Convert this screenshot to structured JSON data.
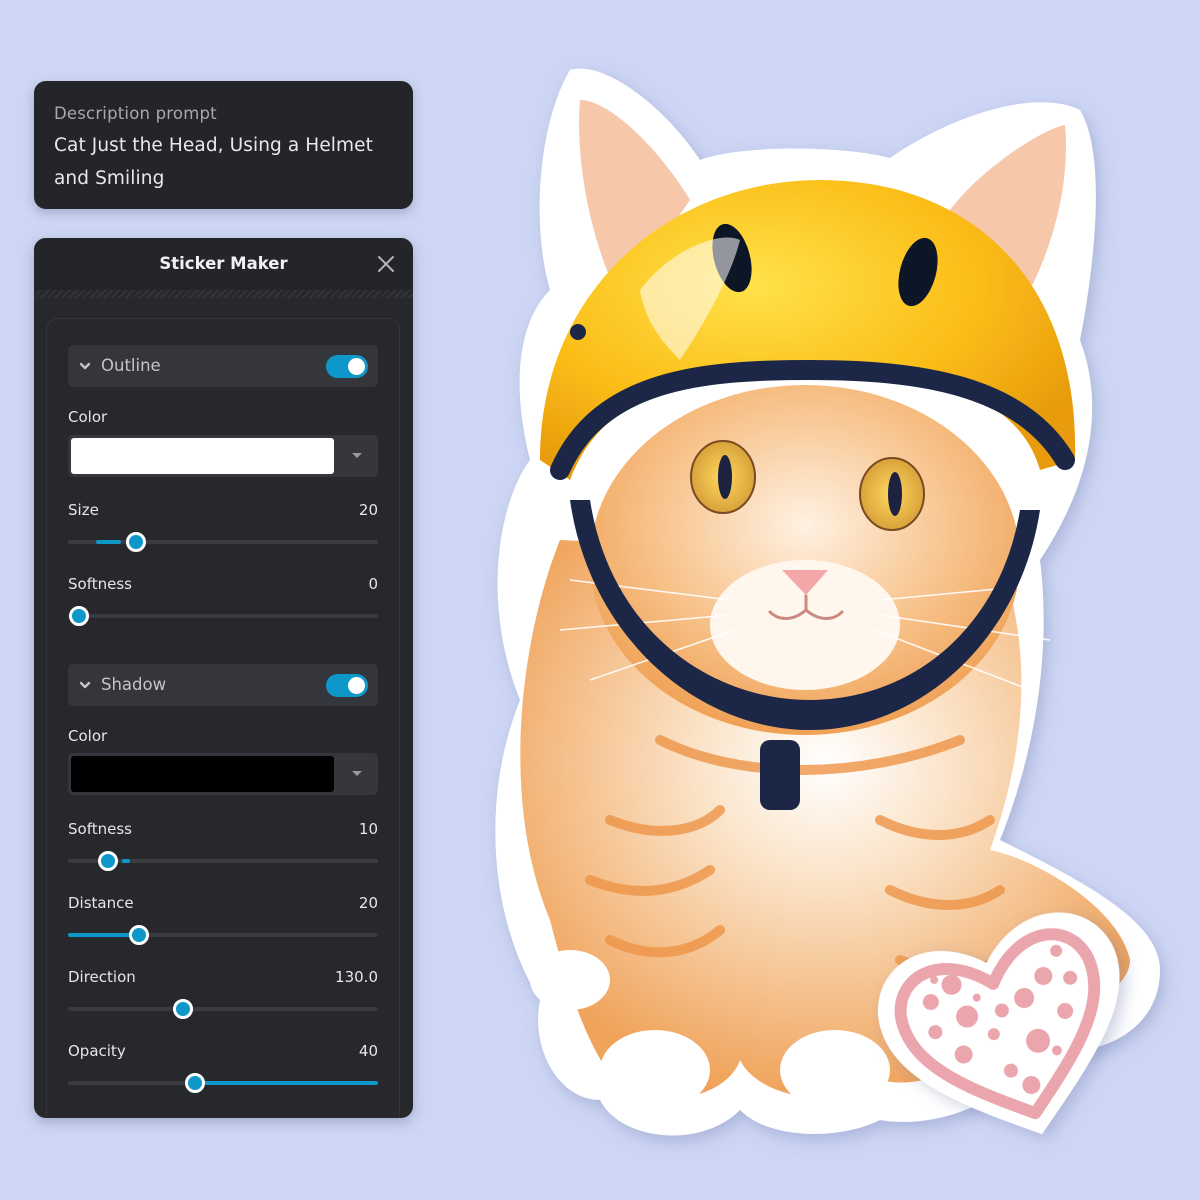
{
  "prompt_card": {
    "label": "Description prompt",
    "text_line1": "Cat Just the Head, Using a Helmet",
    "text_line2": "and Smiling"
  },
  "panel": {
    "title": "Sticker Maker",
    "close_icon": "close-icon",
    "accent_color": "#0e97c9",
    "outline": {
      "label": "Outline",
      "enabled": true,
      "color_label": "Color",
      "color_value": "#ffffff",
      "size": {
        "label": "Size",
        "value": "20",
        "thumb": 0.22,
        "fill_from": 0.09,
        "fill_to": 0.17
      },
      "softness": {
        "label": "Softness",
        "value": "0",
        "thumb": 0.035,
        "fill_from": 0,
        "fill_to": 0
      }
    },
    "shadow": {
      "label": "Shadow",
      "enabled": true,
      "color_label": "Color",
      "color_value": "#000000",
      "softness": {
        "label": "Softness",
        "value": "10",
        "thumb": 0.13,
        "fill_from": 0.175,
        "fill_to": 0.2
      },
      "distance": {
        "label": "Distance",
        "value": "20",
        "thumb": 0.23,
        "fill_from": 0,
        "fill_to": 0.21
      },
      "direction": {
        "label": "Direction",
        "value": "130.0",
        "thumb": 0.37,
        "fill_from": 0,
        "fill_to": 0
      },
      "opacity": {
        "label": "Opacity",
        "value": "40",
        "thumb": 0.41,
        "fill_from": 0.44,
        "fill_to": 1.0
      }
    }
  },
  "canvas": {
    "background_color": "#cdd6f4",
    "sticker_subject": "orange tabby cat wearing a yellow helmet",
    "secondary_sticker": "pink polka-dot heart"
  }
}
